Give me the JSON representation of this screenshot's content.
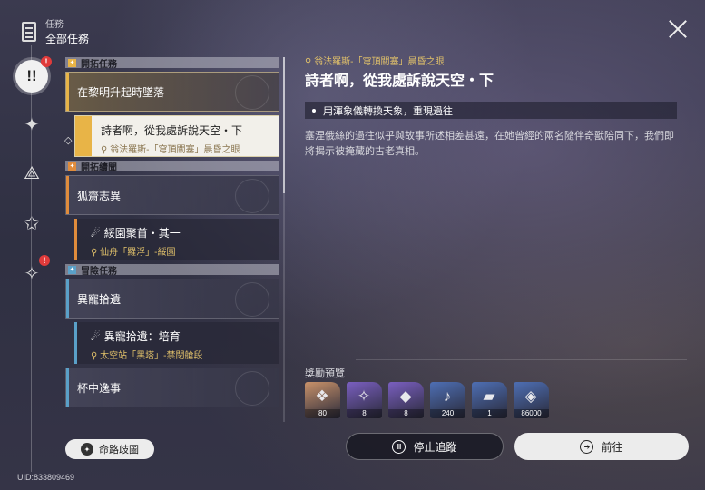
{
  "header": {
    "category": "任務",
    "title": "全部任務"
  },
  "rail": [
    {
      "icon": "all-quests-icon",
      "glyph": "!!",
      "badge": "!"
    },
    {
      "icon": "trailblaze-icon",
      "glyph": "✦",
      "badge": ""
    },
    {
      "icon": "companion-icon",
      "glyph": "⟁",
      "badge": ""
    },
    {
      "icon": "adventure-icon",
      "glyph": "✩",
      "badge": ""
    },
    {
      "icon": "daily-icon",
      "glyph": "✧",
      "badge": "!"
    }
  ],
  "sections": {
    "s1": "開拓任務",
    "s2": "開拓續聞",
    "s3": "冒險任務"
  },
  "quests": {
    "q1": {
      "title": "在黎明升起時墜落"
    },
    "q1s": {
      "title": "詩者啊，從我處訴說天空・下",
      "location": "翁法羅斯-「穹頂關塞」晨昏之眼"
    },
    "q2": {
      "title": "狐齋志異"
    },
    "q2s": {
      "title": "綏園聚首・其一",
      "location": "仙舟「羅浮」-綏園"
    },
    "q3": {
      "title": "異寵拾遺"
    },
    "q3s": {
      "title": "異寵拾遺：培育",
      "location": "太空站「黑塔」-禁閉艙段"
    },
    "q4": {
      "title": "杯中逸事"
    }
  },
  "map_button": "命路歧圖",
  "uid": "UID:833809469",
  "detail": {
    "location": "翁法羅斯-「穹頂關塞」晨昏之眼",
    "title": "詩者啊，從我處訴說天空・下",
    "objective": "用渾象儀轉換天象，重現過往",
    "description": "塞涅俄絲的過往似乎與故事所述相差甚遠，在她曾經的兩名隨伴奇獸陪同下，我們即將揭示被掩藏的古老真相。"
  },
  "rewards_label": "獎勵預覽",
  "rewards": [
    {
      "icon": "stellar-jade-icon",
      "glyph": "❖",
      "count": "80",
      "color": "#c9926a"
    },
    {
      "icon": "traveler-guide-icon",
      "glyph": "✧",
      "count": "8",
      "color": "#7a5fc0"
    },
    {
      "icon": "refined-aether-icon",
      "glyph": "◆",
      "count": "8",
      "color": "#7a5fc0"
    },
    {
      "icon": "guitar-material-icon",
      "glyph": "♪",
      "count": "240",
      "color": "#4e6fb4"
    },
    {
      "icon": "book-material-icon",
      "glyph": "▰",
      "count": "1",
      "color": "#4e6fb4"
    },
    {
      "icon": "credit-icon",
      "glyph": "◈",
      "count": "86000",
      "color": "#4e6fb4"
    }
  ],
  "buttons": {
    "stop": "停止追蹤",
    "go": "前往"
  },
  "colors": {
    "gold": "#e8b447",
    "orange": "#e08c3c",
    "blue": "#5aa0c8",
    "badge": "#e03b3b"
  }
}
